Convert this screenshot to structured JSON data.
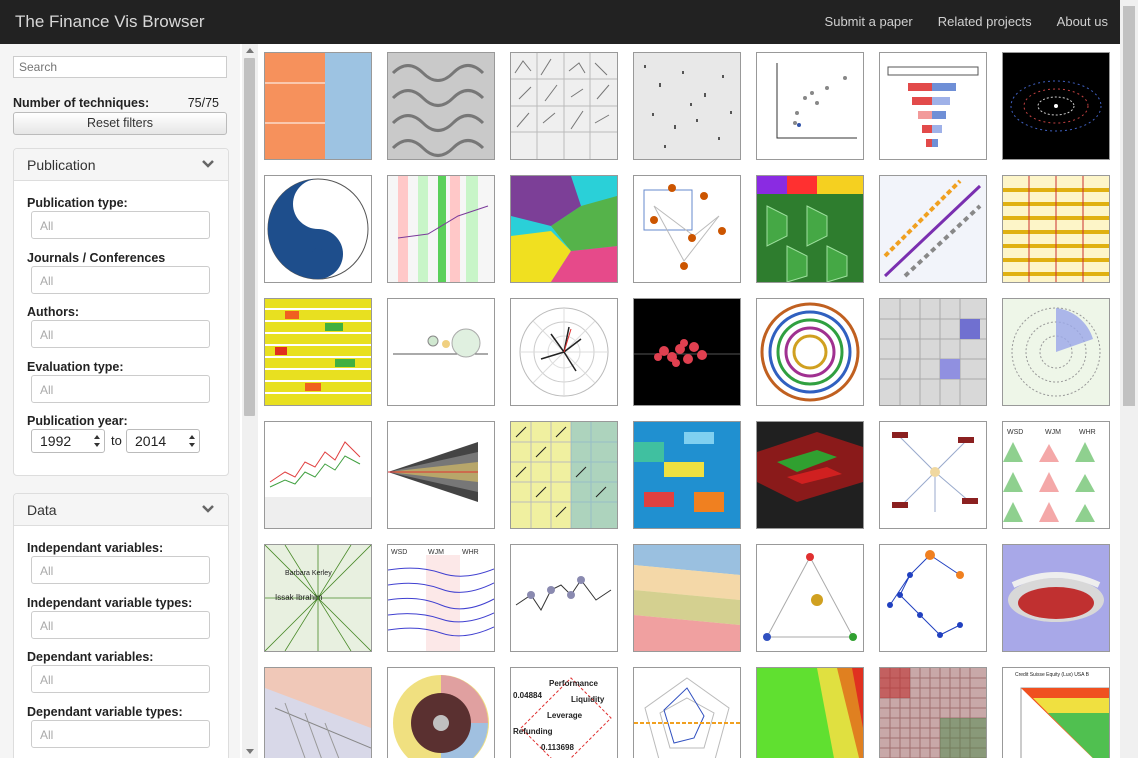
{
  "navbar": {
    "brand": "The Finance Vis Browser",
    "links": [
      "Submit a paper",
      "Related projects",
      "About us"
    ]
  },
  "sidebar": {
    "search_placeholder": "Search",
    "num_label": "Number of techniques:",
    "num_value": "75/75",
    "reset_label": "Reset filters",
    "publication": {
      "title": "Publication",
      "fields": [
        {
          "label": "Publication type:",
          "value": "All"
        },
        {
          "label": "Journals / Conferences",
          "value": "All"
        },
        {
          "label": "Authors:",
          "value": "All"
        },
        {
          "label": "Evaluation type:",
          "value": "All"
        }
      ],
      "year_label": "Publication year:",
      "year_from": "1992",
      "year_to": "2014",
      "to_label": "to"
    },
    "data": {
      "title": "Data",
      "fields": [
        {
          "label": "Independant variables:",
          "value": "All"
        },
        {
          "label": "Independant variable types:",
          "value": "All"
        },
        {
          "label": "Dependant variables:",
          "value": "All"
        },
        {
          "label": "Dependant variable types:",
          "value": "All"
        }
      ]
    }
  },
  "thumb_text": {
    "t33_l1": "WSD",
    "t33_l2": "WJM",
    "t33_l3": "WHR",
    "t35_l1": "WSD",
    "t35_l2": "WJM",
    "t35_l3": "WHR",
    "t36_l1": "Barbara Kerley",
    "t36_l2": "Issak Ibrahim",
    "t43_l1": "Performance",
    "t43_l2": "Liquidity",
    "t43_l3": "Leverage",
    "t43_l4": "0.04884",
    "t43_l5": "0.113698",
    "t43_l6": "Refunding",
    "t48_l1": "Credit Suisse Equity (Lux) USA B"
  }
}
